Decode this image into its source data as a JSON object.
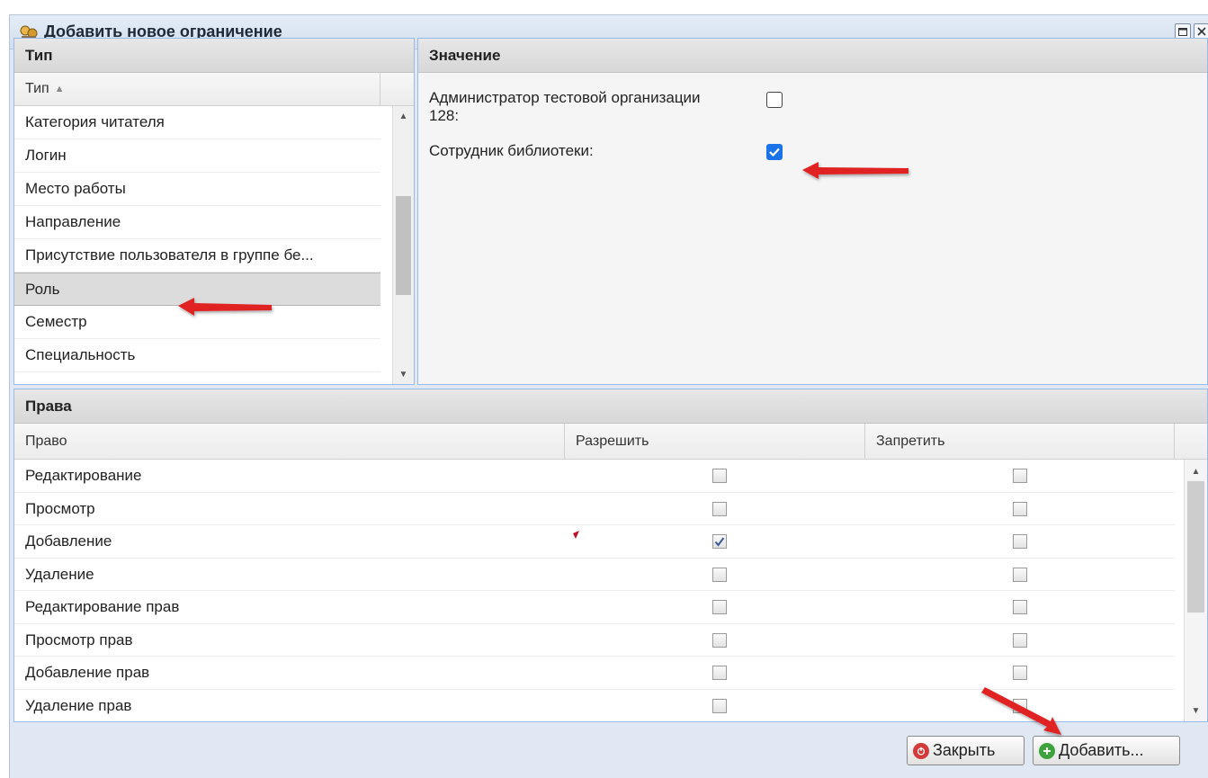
{
  "dialog": {
    "title": "Добавить новое ограничение"
  },
  "type_panel": {
    "title": "Тип",
    "column_header": "Тип",
    "items": [
      "Категория читателя",
      "Логин",
      "Место работы",
      "Направление",
      "Присутствие пользователя в группе бе...",
      "Роль",
      "Семестр",
      "Специальность"
    ],
    "selected_item": "Роль"
  },
  "value_panel": {
    "title": "Значение",
    "options": [
      {
        "label_line1": "Администратор тестовой организации",
        "label_line2": "128:",
        "checked": false
      },
      {
        "label_line1": "Сотрудник библиотеки:",
        "label_line2": "",
        "checked": true
      }
    ]
  },
  "rights_panel": {
    "title": "Права",
    "columns": [
      "Право",
      "Разрешить",
      "Запретить"
    ],
    "rows": [
      {
        "name": "Редактирование",
        "allow": false,
        "deny": false
      },
      {
        "name": "Просмотр",
        "allow": false,
        "deny": false
      },
      {
        "name": "Добавление",
        "allow": true,
        "deny": false
      },
      {
        "name": "Удаление",
        "allow": false,
        "deny": false
      },
      {
        "name": "Редактирование прав",
        "allow": false,
        "deny": false
      },
      {
        "name": "Просмотр прав",
        "allow": false,
        "deny": false
      },
      {
        "name": "Добавление прав",
        "allow": false,
        "deny": false
      },
      {
        "name": "Удаление прав",
        "allow": false,
        "deny": false
      }
    ]
  },
  "buttons": {
    "close_label": "Закрыть",
    "add_label": "Добавить..."
  },
  "colors": {
    "accent_checkbox": "#1a73e8",
    "annotation_arrow": "#e02020",
    "close_icon": "#d33b3b",
    "add_icon": "#3da33d"
  }
}
